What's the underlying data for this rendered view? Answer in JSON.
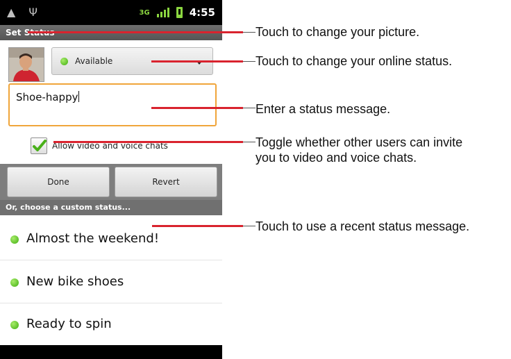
{
  "status_bar": {
    "network": "3G",
    "time": "4:55",
    "icons": [
      "android-icon",
      "usb-icon",
      "3g-icon",
      "signal-icon",
      "battery-icon"
    ]
  },
  "title": "Set Status",
  "presence": {
    "selected": "Available",
    "color": "#4caf1a"
  },
  "status_message": {
    "value": "Shoe-happy"
  },
  "video_chat": {
    "label": "Allow video and voice chats",
    "checked": true
  },
  "buttons": {
    "done": "Done",
    "revert": "Revert"
  },
  "custom_status": {
    "header": "Or, choose a custom status...",
    "items": [
      {
        "label": "Almost the weekend!"
      },
      {
        "label": "New bike shoes"
      },
      {
        "label": "Ready to spin"
      }
    ]
  },
  "callouts": [
    {
      "text": "Touch to change your picture."
    },
    {
      "text": "Touch to change your online status."
    },
    {
      "text": "Enter a status message."
    },
    {
      "line1": "Toggle whether other users can invite",
      "line2": "you to video and voice chats."
    },
    {
      "text": "Touch to use a recent status message."
    }
  ],
  "colors": {
    "accent_callout": "#d9232e",
    "focus_border": "#f0a53a",
    "presence_green": "#4caf1a"
  }
}
